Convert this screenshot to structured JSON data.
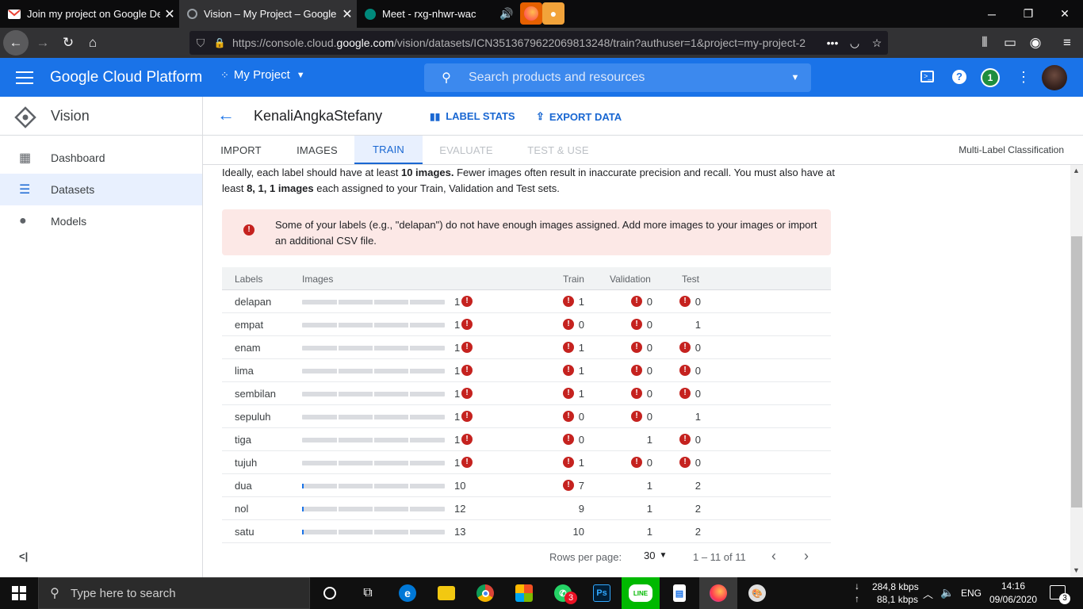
{
  "browser": {
    "tabs": [
      {
        "title": "Join my project on Google Dev",
        "icon": "gmail-icon",
        "active": false
      },
      {
        "title": "Vision – My Project – Google Cl",
        "icon": "gcp-icon",
        "active": true
      },
      {
        "title": "Meet - rxg-nhwr-wac",
        "icon": "meet-icon",
        "active": false
      }
    ],
    "url_prefix": "https://console.cloud.",
    "url_host": "google.com",
    "url_rest": "/vision/datasets/ICN3513679622069813248/train?authuser=1&project=my-project-2",
    "ellipsis": "•••"
  },
  "gcp": {
    "product_name": "Google Cloud Platform",
    "project": "My Project",
    "search_placeholder": "Search products and resources",
    "notification_count": "1"
  },
  "sidebar": {
    "title": "Vision",
    "items": [
      {
        "label": "Dashboard",
        "icon": "dashboard-icon",
        "selected": false
      },
      {
        "label": "Datasets",
        "icon": "list-icon",
        "selected": true
      },
      {
        "label": "Models",
        "icon": "lightbulb-icon",
        "selected": false
      }
    ],
    "collapse_glyph": "<|"
  },
  "header": {
    "dataset_name": "KenaliAngkaStefany",
    "label_stats": "LABEL STATS",
    "export_data": "EXPORT DATA"
  },
  "tabs": {
    "import": "IMPORT",
    "images": "IMAGES",
    "train": "TRAIN",
    "evaluate": "EVALUATE",
    "test_use": "TEST & USE",
    "classification": "Multi-Label Classification"
  },
  "intro": {
    "p1": "Ideally, each label should have at least ",
    "p1_bold": "10 images.",
    "p2": " Fewer images often result in inaccurate precision and recall. You must also have at least ",
    "p2_bold": "8, 1, 1 images",
    "p3": " each assigned to your Train, Validation and Test sets."
  },
  "alert": {
    "text": "Some of your labels (e.g., \"delapan\") do not have enough images assigned. Add more images to your images or import an additional CSV file."
  },
  "table": {
    "headers": {
      "labels": "Labels",
      "images": "Images",
      "train": "Train",
      "validation": "Validation",
      "test": "Test"
    },
    "rows": [
      {
        "label": "delapan",
        "images": "1",
        "images_frac": 0.0,
        "images_err": true,
        "train": "1",
        "train_err": true,
        "validation": "0",
        "validation_err": true,
        "test": "0",
        "test_err": true
      },
      {
        "label": "empat",
        "images": "1",
        "images_frac": 0.0,
        "images_err": true,
        "train": "0",
        "train_err": true,
        "validation": "0",
        "validation_err": true,
        "test": "1",
        "test_err": false
      },
      {
        "label": "enam",
        "images": "1",
        "images_frac": 0.0,
        "images_err": true,
        "train": "1",
        "train_err": true,
        "validation": "0",
        "validation_err": true,
        "test": "0",
        "test_err": true
      },
      {
        "label": "lima",
        "images": "1",
        "images_frac": 0.0,
        "images_err": true,
        "train": "1",
        "train_err": true,
        "validation": "0",
        "validation_err": true,
        "test": "0",
        "test_err": true
      },
      {
        "label": "sembilan",
        "images": "1",
        "images_frac": 0.0,
        "images_err": true,
        "train": "1",
        "train_err": true,
        "validation": "0",
        "validation_err": true,
        "test": "0",
        "test_err": true
      },
      {
        "label": "sepuluh",
        "images": "1",
        "images_frac": 0.0,
        "images_err": true,
        "train": "0",
        "train_err": true,
        "validation": "0",
        "validation_err": true,
        "test": "1",
        "test_err": false
      },
      {
        "label": "tiga",
        "images": "1",
        "images_frac": 0.0,
        "images_err": true,
        "train": "0",
        "train_err": true,
        "validation": "1",
        "validation_err": false,
        "test": "0",
        "test_err": true
      },
      {
        "label": "tujuh",
        "images": "1",
        "images_frac": 0.0,
        "images_err": true,
        "train": "1",
        "train_err": true,
        "validation": "0",
        "validation_err": true,
        "test": "0",
        "test_err": true
      },
      {
        "label": "dua",
        "images": "10",
        "images_frac": 0.01,
        "images_err": false,
        "train": "7",
        "train_err": true,
        "validation": "1",
        "validation_err": false,
        "test": "2",
        "test_err": false
      },
      {
        "label": "nol",
        "images": "12",
        "images_frac": 0.01,
        "images_err": false,
        "train": "9",
        "train_err": false,
        "validation": "1",
        "validation_err": false,
        "test": "2",
        "test_err": false
      },
      {
        "label": "satu",
        "images": "13",
        "images_frac": 0.01,
        "images_err": false,
        "train": "10",
        "train_err": false,
        "validation": "1",
        "validation_err": false,
        "test": "2",
        "test_err": false
      }
    ]
  },
  "pager": {
    "rows_label": "Rows per page:",
    "rows_value": "30",
    "range": "1 – 11 of 11"
  },
  "taskbar": {
    "search_placeholder": "Type here to search",
    "badge": "3",
    "net_down": "284,8 kbps",
    "net_up": "88,1 kbps",
    "lang": "ENG",
    "time": "14:16",
    "date": "09/06/2020",
    "notif_count": "3"
  },
  "colors": {
    "gcp_blue": "#1a73e8",
    "error_red": "#c5221f",
    "alert_bg": "#fce8e6"
  }
}
